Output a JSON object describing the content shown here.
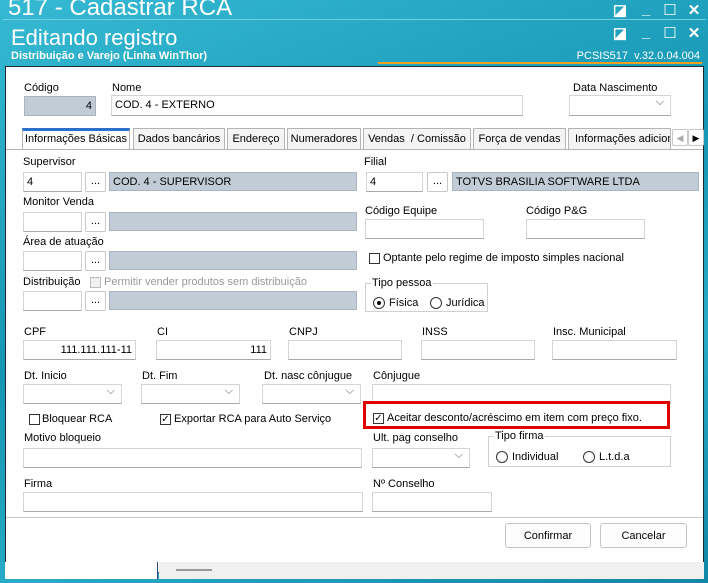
{
  "window": {
    "title": "517 - Cadastrar RCA"
  },
  "dialog": {
    "title": "Editando registro",
    "subtitle": "Distribuição e Varejo (Linha WinThor)",
    "version": "PCSIS517  v.32.0.04.004"
  },
  "controls": {
    "restore": "◪",
    "minimize": "_",
    "maximize": "☐",
    "close": "✕"
  },
  "header": {
    "codigo": {
      "label": "Código",
      "value": "4"
    },
    "nome": {
      "label": "Nome",
      "value": "COD. 4 - EXTERNO"
    },
    "data_nascimento": {
      "label": "Data Nascimento",
      "value": ""
    }
  },
  "tabs": [
    "Informações Básicas",
    "Dados bancários",
    "Endereço",
    "Numeradores",
    "Vendas  / Comissão",
    "Força de vendas",
    "Informações adicionais"
  ],
  "tab_scroll": {
    "left": "◀",
    "right": "▶"
  },
  "form": {
    "supervisor": {
      "label": "Supervisor",
      "code": "4",
      "desc": "COD. 4 - SUPERVISOR"
    },
    "filial": {
      "label": "Filial",
      "code": "4",
      "desc": "TOTVS BRASILIA SOFTWARE LTDA"
    },
    "monitor_venda": {
      "label": "Monitor Venda"
    },
    "area_atuacao": {
      "label": "Área de atuação"
    },
    "distribuicao": {
      "label": "Distribuição",
      "checkbox": "Permitir vender produtos sem distribuição"
    },
    "codigo_equipe": {
      "label": "Código Equipe"
    },
    "codigo_pg": {
      "label": "Código P&G"
    },
    "optante": {
      "label": "Optante pelo regime de imposto simples nacional",
      "checked": false
    },
    "tipo_pessoa": {
      "label": "Tipo pessoa",
      "options": [
        "Física",
        "Jurídica"
      ],
      "selected": "Física"
    },
    "cpf": {
      "label": "CPF",
      "value": "111.111.111-11"
    },
    "ci": {
      "label": "CI",
      "value": "111"
    },
    "cnpj": {
      "label": "CNPJ"
    },
    "inss": {
      "label": "INSS"
    },
    "insc_municipal": {
      "label": "Insc. Municipal"
    },
    "dt_inicio": {
      "label": "Dt. Inicio"
    },
    "dt_fim": {
      "label": "Dt. Fim"
    },
    "dt_nasc_conjugue": {
      "label": "Dt. nasc cônjugue"
    },
    "conjugue": {
      "label": "Cônjugue"
    },
    "bloquear_rca": {
      "label": "Bloquear RCA",
      "checked": false
    },
    "exportar_rca": {
      "label": "Exportar RCA para Auto Serviço",
      "checked": true
    },
    "aceitar_desconto": {
      "label": "Aceitar desconto/acréscimo em item com preço fixo.",
      "checked": true
    },
    "motivo_bloqueio": {
      "label": "Motivo bloqueio"
    },
    "ult_pag_conselho": {
      "label": "Ult. pag conselho"
    },
    "tipo_firma": {
      "label": "Tipo firma",
      "options": [
        "Individual",
        "L.t.d.a"
      ]
    },
    "firma": {
      "label": "Firma"
    },
    "n_conselho": {
      "label": "Nº Conselho"
    },
    "ellipsis": "..."
  },
  "footer": {
    "confirm": "Confirmar",
    "cancel": "Cancelar"
  },
  "colors": {
    "highlight": "#e00000",
    "accent_line": "#f0a020",
    "tab_active": "#2a6fc9"
  }
}
